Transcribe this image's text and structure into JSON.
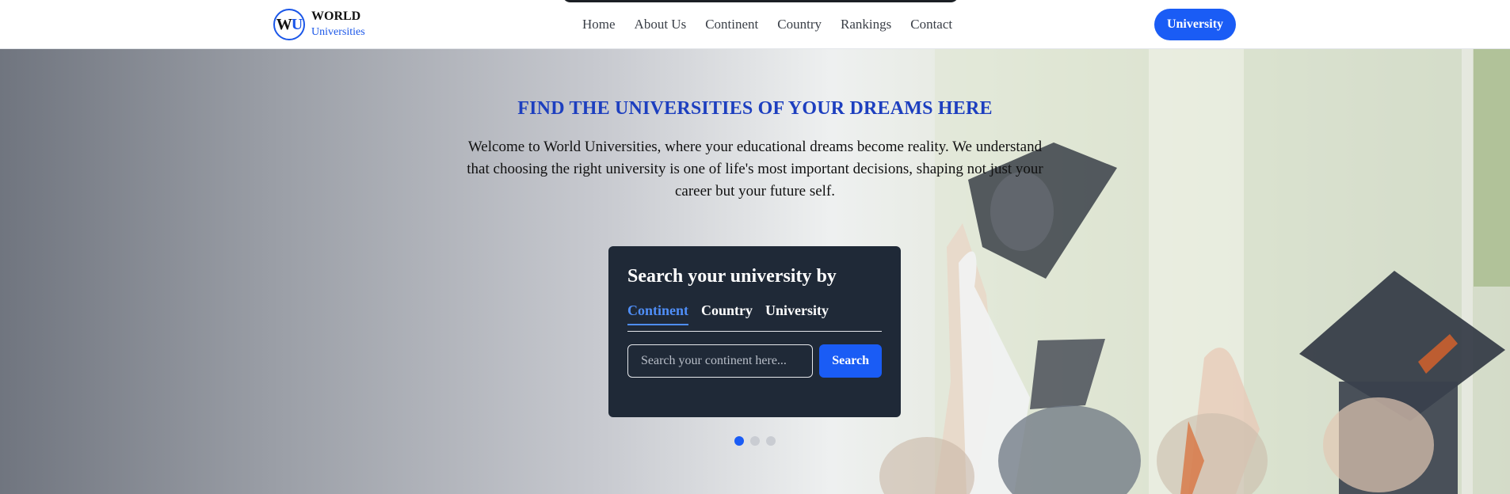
{
  "brand": {
    "logo_initial_1": "W",
    "logo_initial_2": "U",
    "name": "WORLD",
    "subtitle": "Universities"
  },
  "nav": {
    "links": [
      "Home",
      "About Us",
      "Continent",
      "Country",
      "Rankings",
      "Contact"
    ],
    "cta_label": "University"
  },
  "hero": {
    "heading": "FIND THE UNIVERSITIES OF YOUR DREAMS HERE",
    "intro": "Welcome to World Universities, where your educational dreams become reality. We understand that choosing the right university is one of life's most important decisions, shaping not just your career but your future self."
  },
  "search": {
    "title": "Search your university by",
    "tabs": [
      "Continent",
      "Country",
      "University"
    ],
    "active_tab": "Continent",
    "input_value": "",
    "input_placeholder": "Search your continent here...",
    "button_label": "Search"
  },
  "carousel": {
    "slide_count": 3,
    "active_index": 0
  },
  "colors": {
    "accent": "#1a5cf5",
    "heading": "#1d3fbf",
    "card_background": "#1f2937",
    "active_tab": "#4f8ef7"
  }
}
